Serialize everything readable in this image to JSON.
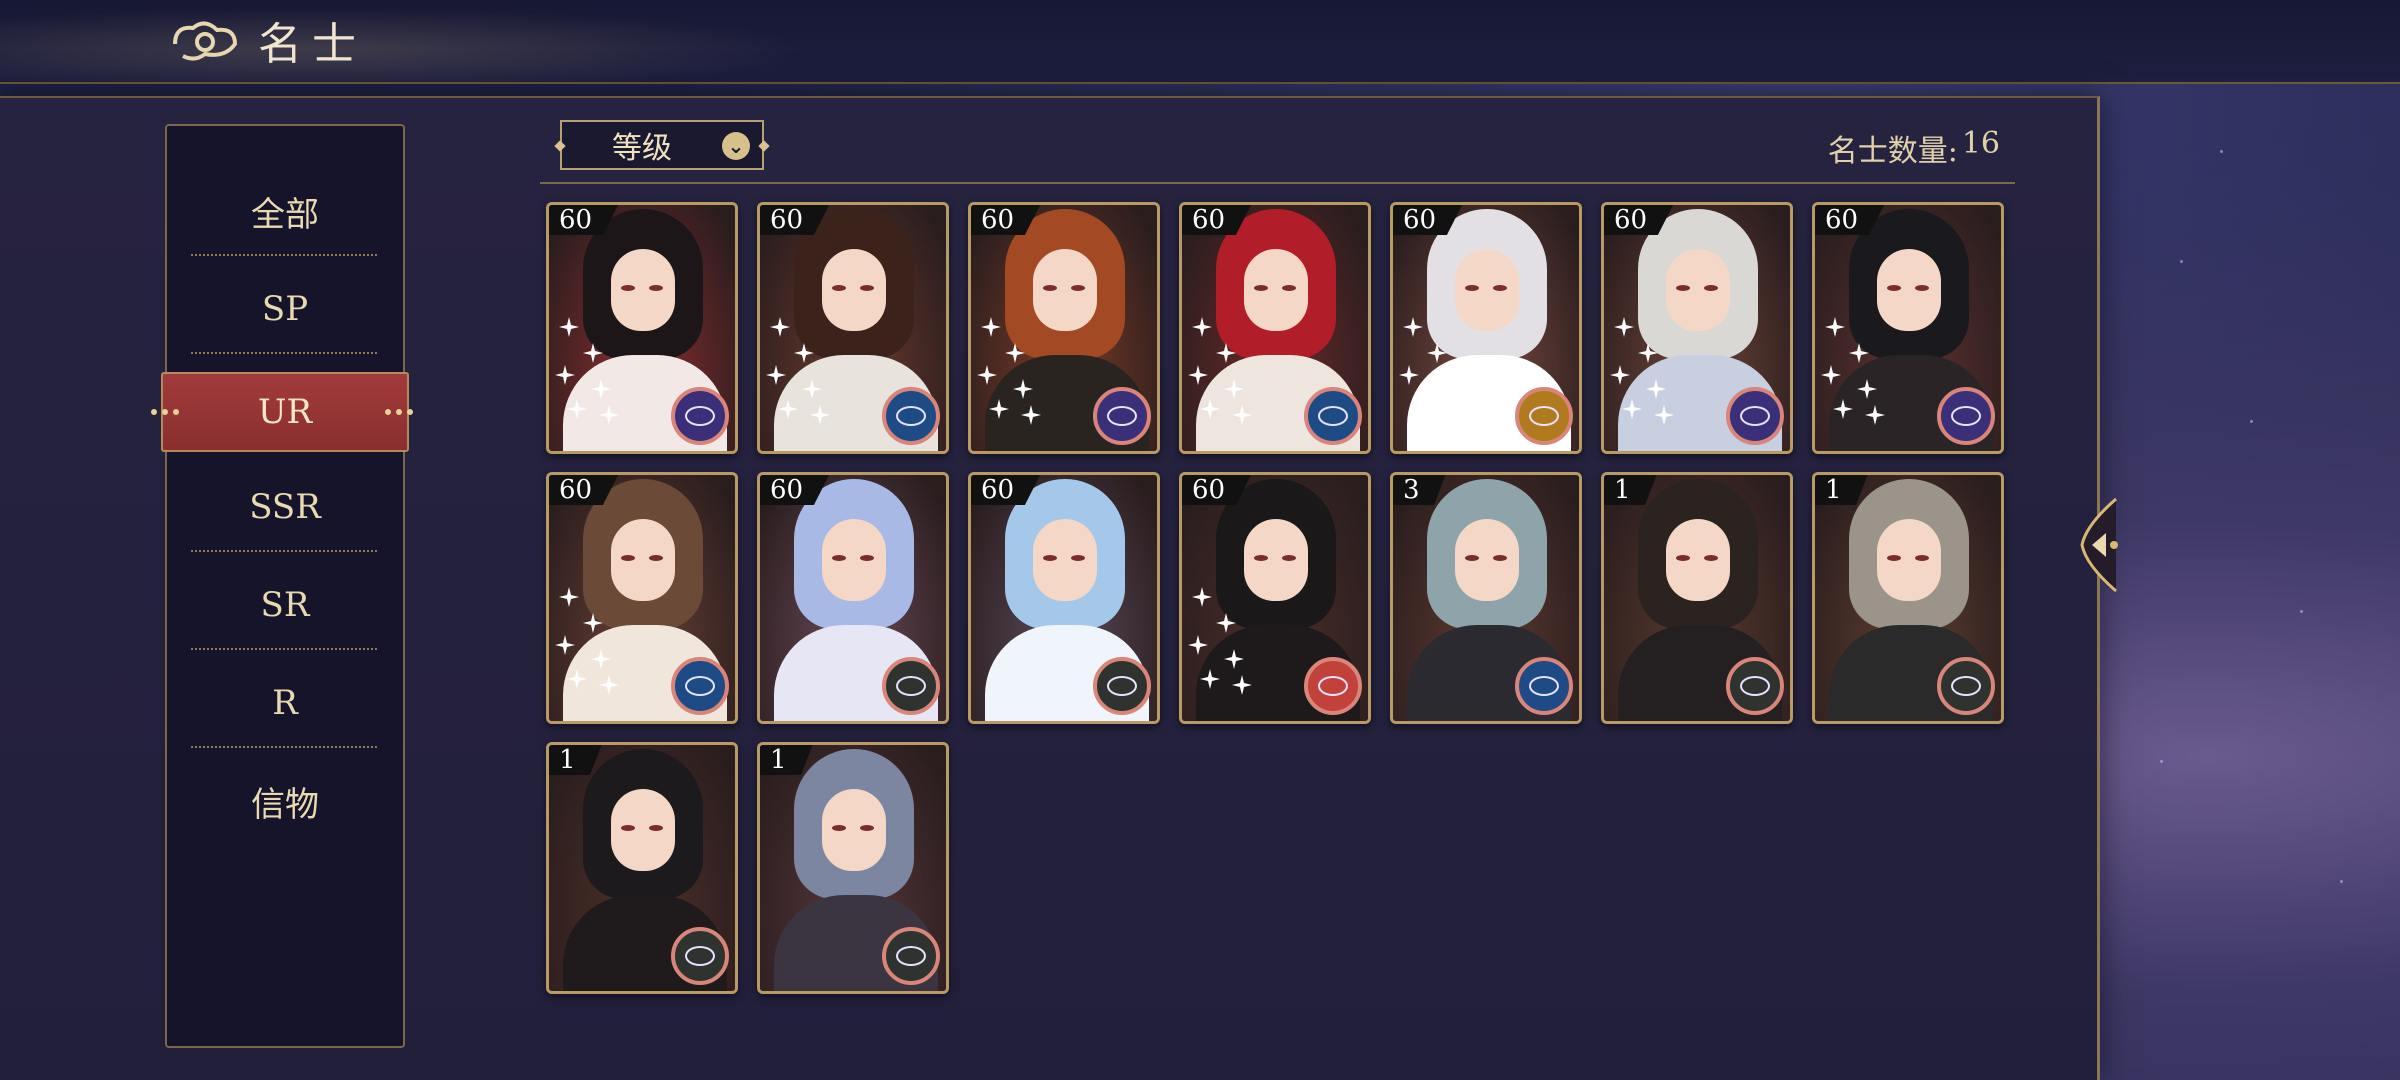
{
  "header": {
    "title": "名士"
  },
  "sidebar": {
    "items": [
      {
        "label": "全部",
        "active": false
      },
      {
        "label": "SP",
        "active": false
      },
      {
        "label": "UR",
        "active": true
      },
      {
        "label": "SSR",
        "active": false
      },
      {
        "label": "SR",
        "active": false
      },
      {
        "label": "R",
        "active": false
      },
      {
        "label": "信物",
        "active": false
      }
    ]
  },
  "toolbar": {
    "sort_label": "等级",
    "count_label": "名士数量:",
    "count_value": "16"
  },
  "colors": {
    "active_tab": "#8a2e2f",
    "gold_border": "#b99a66"
  },
  "cards": [
    {
      "level": "60",
      "badge": "purple-orbit-icon",
      "sparkles": true
    },
    {
      "level": "60",
      "badge": "blue-orbit-icon",
      "sparkles": true
    },
    {
      "level": "60",
      "badge": "purple-orbit-icon",
      "sparkles": true
    },
    {
      "level": "60",
      "badge": "blue-orbit-icon",
      "sparkles": true
    },
    {
      "level": "60",
      "badge": "gold-orbit-icon",
      "sparkles": true
    },
    {
      "level": "60",
      "badge": "purple-orbit-icon",
      "sparkles": true
    },
    {
      "level": "60",
      "badge": "purple-orbit-icon",
      "sparkles": true
    },
    {
      "level": "60",
      "badge": "blue-orbit-icon",
      "sparkles": true
    },
    {
      "level": "60",
      "badge": "grey-orbit-icon",
      "sparkles": false
    },
    {
      "level": "60",
      "badge": "grey-orbit-icon",
      "sparkles": false
    },
    {
      "level": "60",
      "badge": "red-orbit-icon",
      "sparkles": true
    },
    {
      "level": "3",
      "badge": "blue-orbit-icon",
      "sparkles": false
    },
    {
      "level": "1",
      "badge": "grey-orbit-icon",
      "sparkles": false
    },
    {
      "level": "1",
      "badge": "grey-orbit-icon",
      "sparkles": false
    },
    {
      "level": "1",
      "badge": "grey-orbit-icon",
      "sparkles": false
    },
    {
      "level": "1",
      "badge": "grey-orbit-icon",
      "sparkles": false
    }
  ]
}
